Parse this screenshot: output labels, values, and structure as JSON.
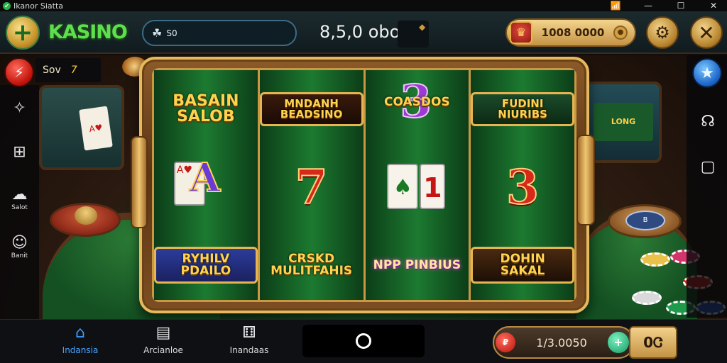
{
  "statusbar": {
    "app_name": "Ikanor Siatta",
    "wifi_icon": "wifi-icon",
    "min_icon": "minimize-icon",
    "restore_icon": "restore-icon",
    "close_icon": "close-icon"
  },
  "header": {
    "logo": "KASINO",
    "search_value": "S0",
    "center_amount": "8,5,0 obog",
    "coin_balance": "1008 0000",
    "plus_icon": "plus-icon",
    "settings_icon": "settings-icon",
    "close_icon": "close-icon"
  },
  "left": {
    "badge_label": "Sov",
    "badge_value": "7",
    "rail": [
      {
        "icon": "chat-icon",
        "label": ""
      },
      {
        "icon": "grid-icon",
        "label": ""
      },
      {
        "icon": "speech-bubble-icon",
        "label": "Salot"
      },
      {
        "icon": "support-icon",
        "label": "Banit"
      }
    ]
  },
  "reels": [
    [
      "BASAIN SALOB",
      "A",
      "RYHILV PDAILO"
    ],
    [
      "MNDANH BEADSINO",
      "7",
      "CRSKD MULITFAHIS"
    ],
    [
      "COASDOS",
      "A1",
      "NPP PINBIUS"
    ],
    [
      "FUDINI NIURIBS",
      "3",
      "DOHIN SAKAL"
    ]
  ],
  "bg": {
    "card_left": "A♥",
    "screen_right": "LONG",
    "dial_right": "B"
  },
  "bottom": {
    "nav": [
      {
        "label": "Indansia",
        "icon": "home-icon"
      },
      {
        "label": "Arcianloe",
        "icon": "cards-icon"
      },
      {
        "label": "Inandaas",
        "icon": "games-icon"
      }
    ],
    "balance": "1/3.0050",
    "balance_end": "0Ꮳ"
  }
}
